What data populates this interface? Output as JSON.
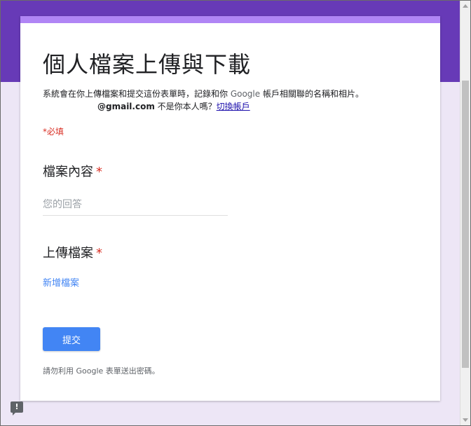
{
  "form": {
    "title": "個人檔案上傳與下載",
    "notice_prefix": "系統會在你上傳檔案和提交這份表單時，記錄和你 ",
    "notice_google": "Google",
    "notice_suffix": " 帳戶相關聯的名稱和相片。",
    "account_email": "@gmail.com",
    "account_not_you": " 不是你本人嗎？",
    "switch_account": "切換帳戶",
    "required_note": "*必填"
  },
  "questions": [
    {
      "title": "檔案內容",
      "required_mark": "*",
      "placeholder": "您的回答",
      "value": ""
    },
    {
      "title": "上傳檔案",
      "required_mark": "*",
      "add_file_label": "新增檔案"
    }
  ],
  "submit_label": "提交",
  "footer_note": "請勿利用 Google 表單送出密碼。",
  "report_icon": "!",
  "colors": {
    "header_band": "#673ab7",
    "card_accent": "#b085f5",
    "page_bg": "#ede6f6",
    "submit_button": "#4285f4",
    "required": "#d93025"
  }
}
